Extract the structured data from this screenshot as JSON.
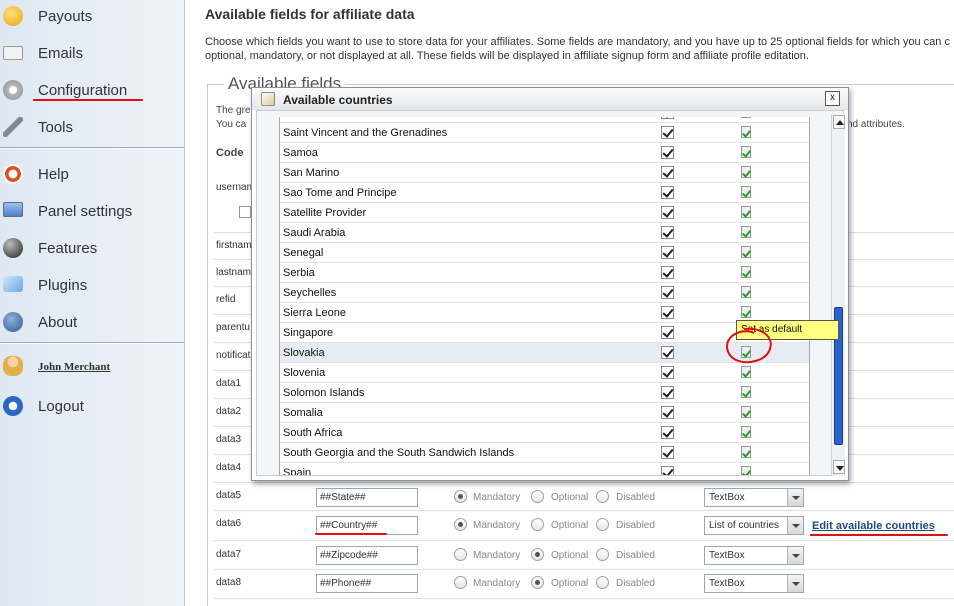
{
  "sidebar": {
    "items": [
      {
        "label": "Payouts",
        "icon": "smiley-coin-icon"
      },
      {
        "label": "Emails",
        "icon": "envelope-icon"
      },
      {
        "label": "Configuration",
        "icon": "gears-icon"
      },
      {
        "label": "Tools",
        "icon": "wrench-icon"
      },
      {
        "label": "Help",
        "icon": "lifebuoy-icon"
      },
      {
        "label": "Panel settings",
        "icon": "monitor-icon"
      },
      {
        "label": "Features",
        "icon": "sphere-icon"
      },
      {
        "label": "Plugins",
        "icon": "puzzle-icon"
      },
      {
        "label": "About",
        "icon": "chart-icon"
      },
      {
        "label": "John Merchant",
        "icon": "user-icon"
      },
      {
        "label": "Logout",
        "icon": "power-icon"
      }
    ]
  },
  "page": {
    "title": "Available fields for affiliate data",
    "description": "Choose which fields you want to use to store data for your affiliates. Some fields are mandatory, and you have up to 25 optional fields for which you can c optional, mandatory, or not displayed at all. These fields will be displayed in affiliate signup form and affiliate profile editation.",
    "fieldset_legend": "Available fields",
    "bg_text_1": "The gre",
    "bg_text_2": "You ca",
    "bg_text_3": "nd attributes.",
    "code_header": "Code",
    "bg_labels": [
      "usernam",
      "firstnam",
      "lastnam",
      "refid",
      "parentu",
      "notificat",
      "data1",
      "data2",
      "data3",
      "data4"
    ],
    "field_rows": [
      {
        "label": "data5",
        "value": "##State##",
        "mode": "Mandatory",
        "type": "TextBox"
      },
      {
        "label": "data6",
        "value": "##Country##",
        "mode": "Mandatory",
        "type": "List of countries"
      },
      {
        "label": "data7",
        "value": "##Zipcode##",
        "mode": "Optional",
        "type": "TextBox"
      },
      {
        "label": "data8",
        "value": "##Phone##",
        "mode": "Optional",
        "type": "TextBox"
      }
    ],
    "radio_labels": [
      "Mandatory",
      "Optional",
      "Disabled"
    ],
    "edit_countries_link": "Edit available countries"
  },
  "modal": {
    "title": "Available countries",
    "close_label": "x",
    "countries": [
      "Saint Vincent and the Grenadines",
      "Samoa",
      "San Marino",
      "Sao Tome and Principe",
      "Satellite Provider",
      "Saudi Arabia",
      "Senegal",
      "Serbia",
      "Seychelles",
      "Sierra Leone",
      "Singapore",
      "Slovakia",
      "Slovenia",
      "Solomon Islands",
      "Somalia",
      "South Africa",
      "South Georgia and the South Sandwich Islands",
      "Spain"
    ],
    "highlighted_country": "Slovakia",
    "tooltip": "Set as default"
  },
  "colors": {
    "annotation": "#e01010",
    "scroll_thumb": "#2b62c8",
    "tooltip_bg": "#ffff80",
    "link": "#264a7a"
  }
}
